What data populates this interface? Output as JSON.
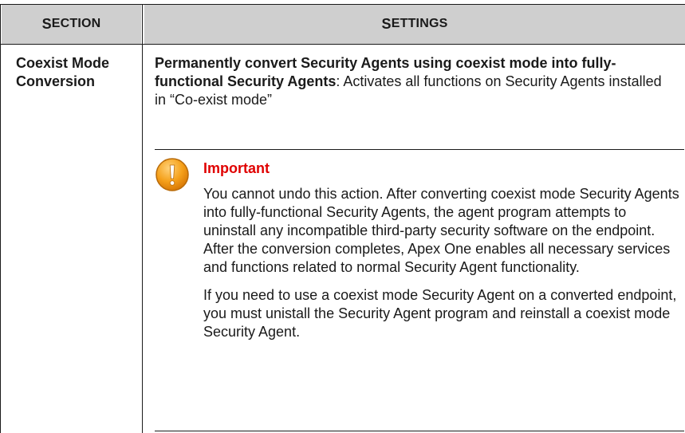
{
  "table": {
    "headers": {
      "section": {
        "initial": "S",
        "rest": "ECTION"
      },
      "settings": {
        "initial": "S",
        "rest": "ETTINGS"
      }
    },
    "rows": [
      {
        "section": "Coexist Mode Conversion",
        "settings_lead": "Permanently convert Security Agents using coexist mode into fully-functional Security Agents",
        "settings_text": ": Activates all functions on Security Agents installed in “Co-exist mode”",
        "note": {
          "icon": "warning-icon",
          "title": "Important",
          "paragraphs": [
            "You cannot undo this action. After converting coexist mode Security Agents into fully-functional Security Agents, the agent program attempts to uninstall any incompatible third-party security software on the endpoint. After the conversion completes, Apex One enables all necessary services and functions related to normal Security Agent functionality.",
            "If you need to use a coexist mode Security Agent on a converted endpoint, you must unistall the Security Agent program and reinstall a coexist mode Security Agent."
          ]
        }
      }
    ]
  },
  "colors": {
    "header_bg": "#cfcfcf",
    "note_title": "#e00000",
    "icon_fill": "#f5a01a",
    "text": "#1a1a1a"
  }
}
